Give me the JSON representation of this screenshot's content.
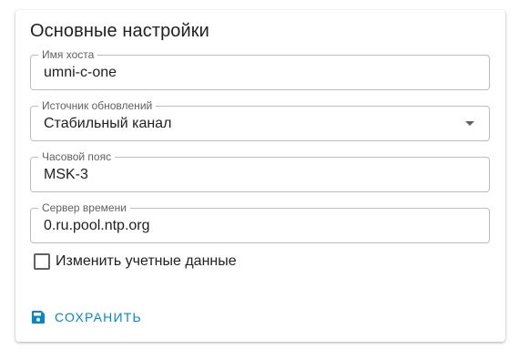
{
  "card": {
    "title": "Основные настройки"
  },
  "fields": {
    "hostname": {
      "label": "Имя хоста",
      "value": "umni-c-one"
    },
    "update_source": {
      "label": "Источник обновлений",
      "value": "Стабильный канал"
    },
    "timezone": {
      "label": "Часовой пояс",
      "value": "MSK-3"
    },
    "time_server": {
      "label": "Сервер времени",
      "value": "0.ru.pool.ntp.org"
    }
  },
  "credentials_checkbox": {
    "label": "Изменить учетные данные",
    "checked": false
  },
  "save_button": {
    "label": "СОХРАНИТЬ",
    "icon": "floppy-disk-icon"
  },
  "colors": {
    "accent": "#0288d1",
    "text": "#212121",
    "muted": "#616161",
    "border": "#bdbdbd"
  }
}
